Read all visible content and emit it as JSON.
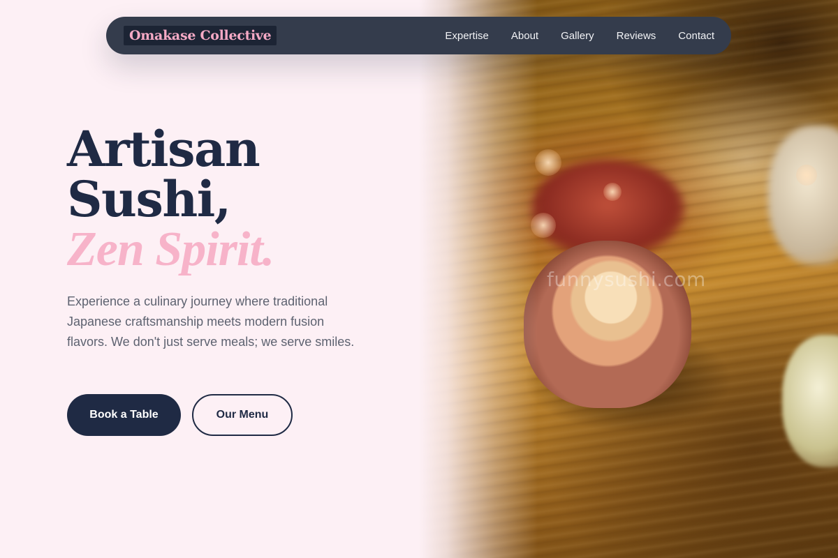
{
  "navbar": {
    "brand": "Omakase Collective",
    "links": [
      "Expertise",
      "About",
      "Gallery",
      "Reviews",
      "Contact"
    ]
  },
  "hero": {
    "headline_line1": "Artisan",
    "headline_line2": "Sushi,",
    "headline_accent": "Zen Spirit.",
    "description": "Experience a culinary journey where traditional Japanese craftsmanship meets modern fusion flavors. We don't just serve meals; we serve smiles.",
    "primary_button": "Book a Table",
    "secondary_button": "Our Menu",
    "image_watermark": "funnysushi.com"
  },
  "colors": {
    "background": "#fdf0f5",
    "navy": "#1f2a44",
    "navbar": "#343c4c",
    "pink_accent": "#f7b3c9",
    "brand_pink": "#f5a9c5",
    "body_text": "#5d6270"
  }
}
